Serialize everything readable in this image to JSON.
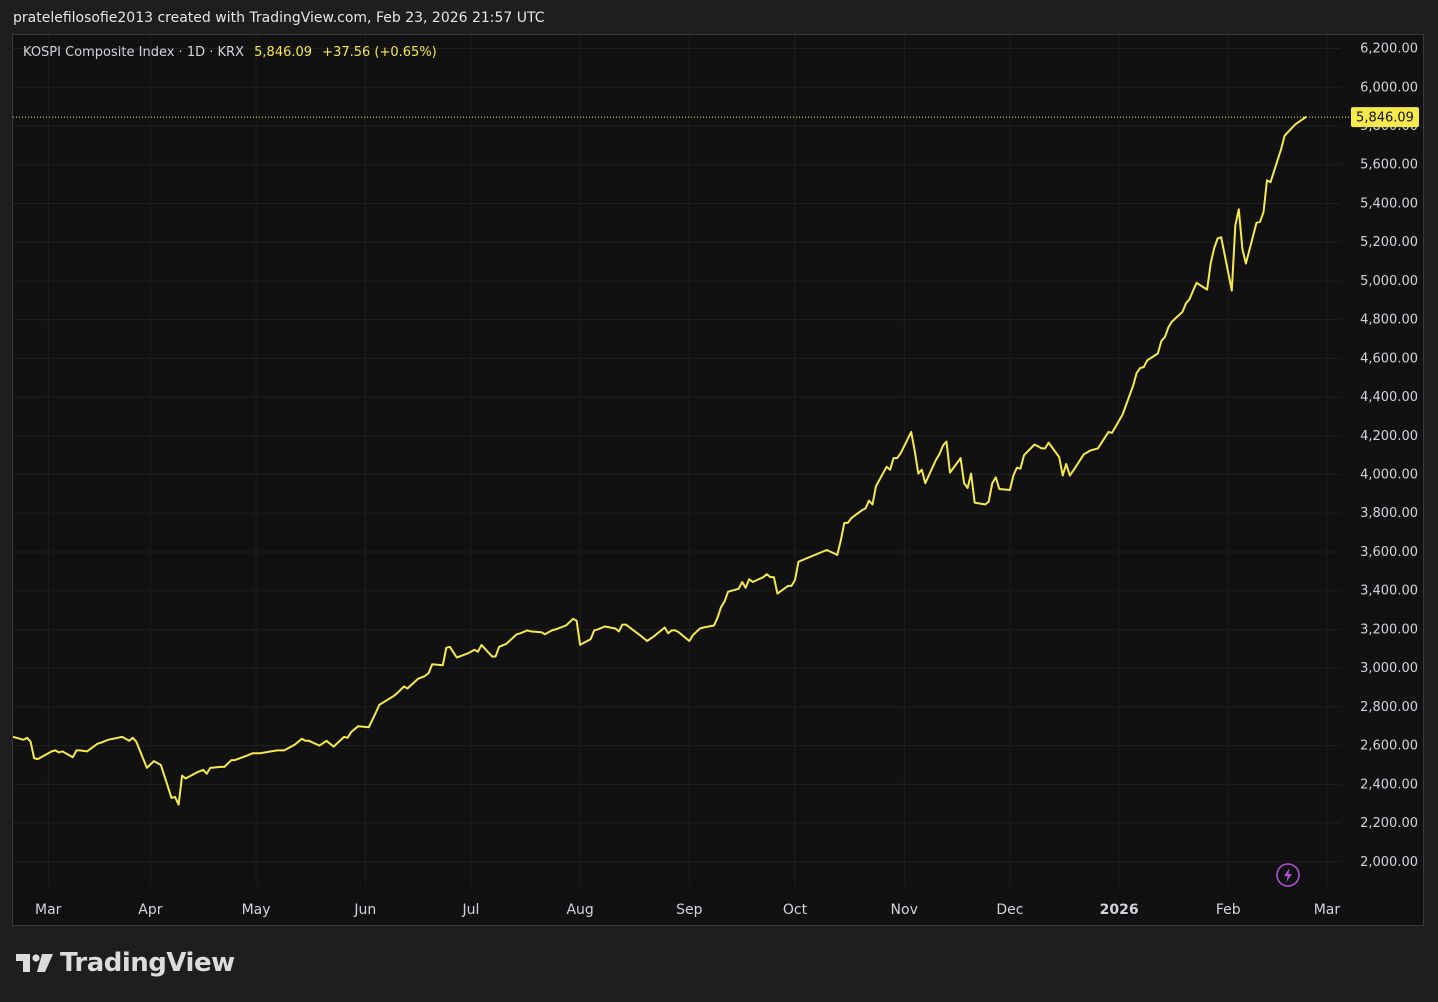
{
  "header": {
    "caption": "pratelefilosofie2013 created with TradingView.com, Feb 23, 2026 21:57 UTC"
  },
  "legend": {
    "symbol": "KOSPI Composite Index",
    "interval": "1D",
    "exchange": "KRX",
    "separator": "·",
    "last": "5,846.09",
    "change": "+37.56",
    "change_pct": "(+0.65%)"
  },
  "branding": {
    "logo_text": "TradingView",
    "logo_icon": "tradingview-logo-icon"
  },
  "colors": {
    "line": "#f5e94c",
    "background": "#111111",
    "grid": "#1f1f1f",
    "axis_text": "#d1d4dc",
    "price_label_bg": "#f5e94c",
    "flash_icon": "#b54fd8"
  },
  "icons": {
    "flash": "lightning-icon"
  },
  "chart_data": {
    "type": "line",
    "title": "KOSPI Composite Index · 1D · KRX",
    "ylim": [
      1880,
      6270
    ],
    "y_ticks": [
      2000,
      2200,
      2400,
      2600,
      2800,
      3000,
      3200,
      3400,
      3600,
      3800,
      4000,
      4200,
      4400,
      4600,
      4800,
      5000,
      5200,
      5400,
      5600,
      5800,
      6000,
      6200
    ],
    "y_tick_labels": [
      "2,000.00",
      "2,200.00",
      "2,400.00",
      "2,600.00",
      "2,800.00",
      "3,000.00",
      "3,200.00",
      "3,400.00",
      "3,600.00",
      "3,800.00",
      "4,000.00",
      "4,200.00",
      "4,400.00",
      "4,600.00",
      "4,800.00",
      "5,000.00",
      "5,200.00",
      "5,400.00",
      "5,600.00",
      "5,800.00",
      "6,000.00",
      "6,200.00"
    ],
    "x_range": [
      "2025-02-21",
      "2026-03-05"
    ],
    "x_ticks": [
      {
        "label": "Mar",
        "date": "2025-03-03",
        "bold": false
      },
      {
        "label": "Apr",
        "date": "2025-04-01",
        "bold": false
      },
      {
        "label": "May",
        "date": "2025-05-01",
        "bold": false
      },
      {
        "label": "Jun",
        "date": "2025-06-01",
        "bold": false
      },
      {
        "label": "Jul",
        "date": "2025-07-01",
        "bold": false
      },
      {
        "label": "Aug",
        "date": "2025-08-01",
        "bold": false
      },
      {
        "label": "Sep",
        "date": "2025-09-01",
        "bold": false
      },
      {
        "label": "Oct",
        "date": "2025-10-01",
        "bold": false
      },
      {
        "label": "Nov",
        "date": "2025-11-01",
        "bold": false
      },
      {
        "label": "Dec",
        "date": "2025-12-01",
        "bold": false
      },
      {
        "label": "2026",
        "date": "2026-01-01",
        "bold": true
      },
      {
        "label": "Feb",
        "date": "2026-02-01",
        "bold": false
      },
      {
        "label": "Mar",
        "date": "2026-03-01",
        "bold": false
      }
    ],
    "last_value": 5846.09,
    "last_value_label": "5,846.09",
    "series": [
      {
        "name": "KOSPI Composite Index",
        "points": [
          [
            "2025-02-21",
            2645
          ],
          [
            "2025-02-24",
            2630
          ],
          [
            "2025-02-25",
            2640
          ],
          [
            "2025-02-26",
            2620
          ],
          [
            "2025-02-27",
            2535
          ],
          [
            "2025-02-28",
            2530
          ],
          [
            "2025-03-04",
            2570
          ],
          [
            "2025-03-05",
            2575
          ],
          [
            "2025-03-06",
            2565
          ],
          [
            "2025-03-07",
            2570
          ],
          [
            "2025-03-10",
            2540
          ],
          [
            "2025-03-11",
            2575
          ],
          [
            "2025-03-12",
            2575
          ],
          [
            "2025-03-14",
            2570
          ],
          [
            "2025-03-17",
            2610
          ],
          [
            "2025-03-18",
            2615
          ],
          [
            "2025-03-20",
            2630
          ],
          [
            "2025-03-24",
            2645
          ],
          [
            "2025-03-26",
            2625
          ],
          [
            "2025-03-27",
            2640
          ],
          [
            "2025-03-28",
            2620
          ],
          [
            "2025-03-31",
            2485
          ],
          [
            "2025-04-02",
            2520
          ],
          [
            "2025-04-04",
            2500
          ],
          [
            "2025-04-07",
            2330
          ],
          [
            "2025-04-08",
            2335
          ],
          [
            "2025-04-09",
            2295
          ],
          [
            "2025-04-10",
            2445
          ],
          [
            "2025-04-11",
            2430
          ],
          [
            "2025-04-14",
            2460
          ],
          [
            "2025-04-16",
            2475
          ],
          [
            "2025-04-17",
            2455
          ],
          [
            "2025-04-18",
            2485
          ],
          [
            "2025-04-21",
            2490
          ],
          [
            "2025-04-22",
            2490
          ],
          [
            "2025-04-24",
            2525
          ],
          [
            "2025-04-25",
            2525
          ],
          [
            "2025-04-28",
            2545
          ],
          [
            "2025-04-30",
            2560
          ],
          [
            "2025-05-02",
            2560
          ],
          [
            "2025-05-07",
            2575
          ],
          [
            "2025-05-09",
            2575
          ],
          [
            "2025-05-12",
            2605
          ],
          [
            "2025-05-14",
            2635
          ],
          [
            "2025-05-15",
            2625
          ],
          [
            "2025-05-16",
            2625
          ],
          [
            "2025-05-19",
            2600
          ],
          [
            "2025-05-21",
            2625
          ],
          [
            "2025-05-23",
            2595
          ],
          [
            "2025-05-26",
            2645
          ],
          [
            "2025-05-27",
            2640
          ],
          [
            "2025-05-28",
            2670
          ],
          [
            "2025-05-30",
            2700
          ],
          [
            "2025-06-02",
            2695
          ],
          [
            "2025-06-04",
            2770
          ],
          [
            "2025-06-05",
            2810
          ],
          [
            "2025-06-09",
            2855
          ],
          [
            "2025-06-10",
            2870
          ],
          [
            "2025-06-12",
            2905
          ],
          [
            "2025-06-13",
            2895
          ],
          [
            "2025-06-16",
            2945
          ],
          [
            "2025-06-18",
            2960
          ],
          [
            "2025-06-19",
            2975
          ],
          [
            "2025-06-20",
            3020
          ],
          [
            "2025-06-23",
            3015
          ],
          [
            "2025-06-24",
            3105
          ],
          [
            "2025-06-25",
            3110
          ],
          [
            "2025-06-27",
            3055
          ],
          [
            "2025-06-30",
            3075
          ],
          [
            "2025-07-02",
            3095
          ],
          [
            "2025-07-03",
            3085
          ],
          [
            "2025-07-04",
            3120
          ],
          [
            "2025-07-07",
            3060
          ],
          [
            "2025-07-08",
            3060
          ],
          [
            "2025-07-09",
            3110
          ],
          [
            "2025-07-11",
            3125
          ],
          [
            "2025-07-14",
            3175
          ],
          [
            "2025-07-15",
            3180
          ],
          [
            "2025-07-17",
            3195
          ],
          [
            "2025-07-18",
            3190
          ],
          [
            "2025-07-21",
            3185
          ],
          [
            "2025-07-22",
            3175
          ],
          [
            "2025-07-24",
            3195
          ],
          [
            "2025-07-25",
            3200
          ],
          [
            "2025-07-28",
            3220
          ],
          [
            "2025-07-30",
            3255
          ],
          [
            "2025-07-31",
            3245
          ],
          [
            "2025-08-01",
            3120
          ],
          [
            "2025-08-04",
            3150
          ],
          [
            "2025-08-05",
            3195
          ],
          [
            "2025-08-06",
            3200
          ],
          [
            "2025-08-08",
            3215
          ],
          [
            "2025-08-11",
            3205
          ],
          [
            "2025-08-12",
            3190
          ],
          [
            "2025-08-13",
            3225
          ],
          [
            "2025-08-14",
            3225
          ],
          [
            "2025-08-18",
            3170
          ],
          [
            "2025-08-20",
            3140
          ],
          [
            "2025-08-22",
            3165
          ],
          [
            "2025-08-25",
            3210
          ],
          [
            "2025-08-26",
            3180
          ],
          [
            "2025-08-27",
            3195
          ],
          [
            "2025-08-28",
            3195
          ],
          [
            "2025-08-29",
            3185
          ],
          [
            "2025-09-01",
            3140
          ],
          [
            "2025-09-02",
            3170
          ],
          [
            "2025-09-04",
            3205
          ],
          [
            "2025-09-05",
            3210
          ],
          [
            "2025-09-08",
            3220
          ],
          [
            "2025-09-09",
            3260
          ],
          [
            "2025-09-10",
            3315
          ],
          [
            "2025-09-11",
            3345
          ],
          [
            "2025-09-12",
            3395
          ],
          [
            "2025-09-15",
            3410
          ],
          [
            "2025-09-16",
            3445
          ],
          [
            "2025-09-17",
            3415
          ],
          [
            "2025-09-18",
            3460
          ],
          [
            "2025-09-19",
            3445
          ],
          [
            "2025-09-22",
            3470
          ],
          [
            "2025-09-23",
            3485
          ],
          [
            "2025-09-24",
            3470
          ],
          [
            "2025-09-25",
            3470
          ],
          [
            "2025-09-26",
            3385
          ],
          [
            "2025-09-29",
            3425
          ],
          [
            "2025-09-30",
            3425
          ],
          [
            "2025-10-01",
            3455
          ],
          [
            "2025-10-02",
            3550
          ],
          [
            "2025-10-10",
            3610
          ],
          [
            "2025-10-13",
            3585
          ],
          [
            "2025-10-14",
            3660
          ],
          [
            "2025-10-15",
            3750
          ],
          [
            "2025-10-16",
            3750
          ],
          [
            "2025-10-17",
            3775
          ],
          [
            "2025-10-20",
            3815
          ],
          [
            "2025-10-21",
            3825
          ],
          [
            "2025-10-22",
            3865
          ],
          [
            "2025-10-23",
            3845
          ],
          [
            "2025-10-24",
            3940
          ],
          [
            "2025-10-27",
            4040
          ],
          [
            "2025-10-28",
            4025
          ],
          [
            "2025-10-29",
            4085
          ],
          [
            "2025-10-30",
            4085
          ],
          [
            "2025-10-31",
            4110
          ],
          [
            "2025-11-03",
            4220
          ],
          [
            "2025-11-04",
            4120
          ],
          [
            "2025-11-05",
            4005
          ],
          [
            "2025-11-06",
            4025
          ],
          [
            "2025-11-07",
            3955
          ],
          [
            "2025-11-10",
            4075
          ],
          [
            "2025-11-11",
            4105
          ],
          [
            "2025-11-12",
            4150
          ],
          [
            "2025-11-13",
            4170
          ],
          [
            "2025-11-14",
            4010
          ],
          [
            "2025-11-17",
            4085
          ],
          [
            "2025-11-18",
            3955
          ],
          [
            "2025-11-19",
            3930
          ],
          [
            "2025-11-20",
            4005
          ],
          [
            "2025-11-21",
            3855
          ],
          [
            "2025-11-24",
            3845
          ],
          [
            "2025-11-25",
            3860
          ],
          [
            "2025-11-26",
            3955
          ],
          [
            "2025-11-27",
            3985
          ],
          [
            "2025-11-28",
            3925
          ],
          [
            "2025-12-01",
            3920
          ],
          [
            "2025-12-02",
            3995
          ],
          [
            "2025-12-03",
            4035
          ],
          [
            "2025-12-04",
            4030
          ],
          [
            "2025-12-05",
            4100
          ],
          [
            "2025-12-08",
            4155
          ],
          [
            "2025-12-09",
            4145
          ],
          [
            "2025-12-10",
            4135
          ],
          [
            "2025-12-11",
            4135
          ],
          [
            "2025-12-12",
            4165
          ],
          [
            "2025-12-15",
            4090
          ],
          [
            "2025-12-16",
            3995
          ],
          [
            "2025-12-17",
            4055
          ],
          [
            "2025-12-18",
            3995
          ],
          [
            "2025-12-19",
            4020
          ],
          [
            "2025-12-22",
            4105
          ],
          [
            "2025-12-23",
            4115
          ],
          [
            "2025-12-24",
            4125
          ],
          [
            "2025-12-26",
            4135
          ],
          [
            "2025-12-29",
            4220
          ],
          [
            "2025-12-30",
            4215
          ],
          [
            "2026-01-02",
            4310
          ],
          [
            "2026-01-05",
            4460
          ],
          [
            "2026-01-06",
            4525
          ],
          [
            "2026-01-07",
            4550
          ],
          [
            "2026-01-08",
            4555
          ],
          [
            "2026-01-09",
            4590
          ],
          [
            "2026-01-12",
            4625
          ],
          [
            "2026-01-13",
            4690
          ],
          [
            "2026-01-14",
            4710
          ],
          [
            "2026-01-15",
            4760
          ],
          [
            "2026-01-16",
            4790
          ],
          [
            "2026-01-19",
            4840
          ],
          [
            "2026-01-20",
            4885
          ],
          [
            "2026-01-21",
            4905
          ],
          [
            "2026-01-22",
            4950
          ],
          [
            "2026-01-23",
            4990
          ],
          [
            "2026-01-26",
            4955
          ],
          [
            "2026-01-27",
            5090
          ],
          [
            "2026-01-28",
            5170
          ],
          [
            "2026-01-29",
            5220
          ],
          [
            "2026-01-30",
            5225
          ],
          [
            "2026-02-02",
            4950
          ],
          [
            "2026-02-03",
            5285
          ],
          [
            "2026-02-04",
            5370
          ],
          [
            "2026-02-05",
            5165
          ],
          [
            "2026-02-06",
            5090
          ],
          [
            "2026-02-09",
            5300
          ],
          [
            "2026-02-10",
            5305
          ],
          [
            "2026-02-11",
            5355
          ],
          [
            "2026-02-12",
            5520
          ],
          [
            "2026-02-13",
            5510
          ],
          [
            "2026-02-16",
            5680
          ],
          [
            "2026-02-17",
            5750
          ],
          [
            "2026-02-20",
            5808.53
          ],
          [
            "2026-02-23",
            5846.09
          ]
        ]
      }
    ]
  }
}
